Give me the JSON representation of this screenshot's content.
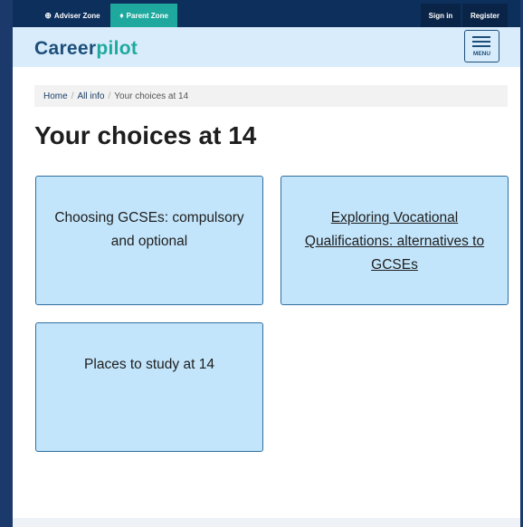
{
  "topbar": {
    "adviser_zone": "Adviser Zone",
    "parent_zone": "Parent Zone",
    "sign_in": "Sign in",
    "register": "Register",
    "adviser_icon": "compass-icon",
    "parent_icon": "person-icon"
  },
  "header": {
    "logo_career": "Career",
    "logo_pilot": "pilot",
    "menu_label": "MENU"
  },
  "breadcrumb": {
    "home": "Home",
    "all_info": "All info",
    "current": "Your choices at 14"
  },
  "page": {
    "title": "Your choices at 14"
  },
  "cards": [
    {
      "label": "Choosing GCSEs: compulsory and optional"
    },
    {
      "label": "Exploring Vocational Qualifications: alternatives to GCSEs"
    },
    {
      "label": "Places to study at 14"
    }
  ],
  "colors": {
    "topbar": "#0d2f5c",
    "parent_zone": "#1fa99e",
    "header": "#d9ecfb",
    "card": "#c3e5fb",
    "card_border": "#2f6ea0"
  }
}
